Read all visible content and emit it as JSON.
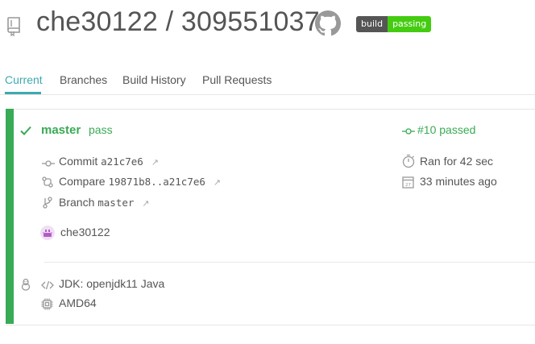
{
  "header": {
    "repo_title": "che30122 / 309551037",
    "badge_left": "build",
    "badge_right": "passing"
  },
  "tabs": [
    "Current",
    "Branches",
    "Build History",
    "Pull Requests"
  ],
  "build": {
    "branch_name": "master",
    "status_text": "pass",
    "build_number_text": "#10 passed",
    "commit_label": "Commit",
    "commit_sha": "a21c7e6",
    "compare_label": "Compare",
    "compare_range": "19871b8..a21c7e6",
    "branch_label": "Branch",
    "branch_value": "master",
    "duration": "Ran for 42 sec",
    "finished": "33 minutes ago",
    "author": "che30122"
  },
  "job": {
    "language": "JDK: openjdk11 Java",
    "arch": "AMD64"
  },
  "colors": {
    "success": "#39aa56",
    "accent_tab": "#3eaaaf",
    "badge_green": "#44cc11"
  },
  "icons": [
    "repo-icon",
    "github-icon",
    "check-icon",
    "commit-icon",
    "compare-icon",
    "branch-icon",
    "external-link-icon",
    "stopwatch-icon",
    "calendar-icon",
    "avatar",
    "linux-icon",
    "code-icon",
    "cpu-icon"
  ]
}
